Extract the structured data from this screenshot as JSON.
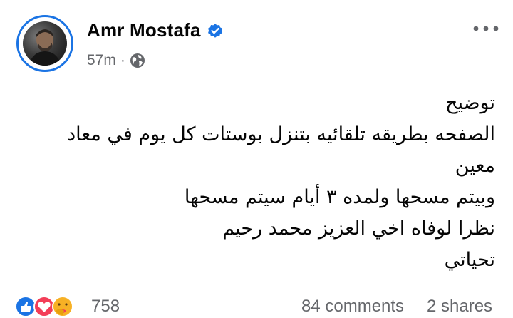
{
  "post": {
    "author": "Amr Mostafa",
    "time": "57m",
    "separator": "·",
    "audience_icon": "globe-icon",
    "verified_icon": "verified-badge-icon",
    "more_icon": "more-options-icon",
    "body_lines": [
      "توضيح",
      "الصفحه بطريقه تلقائيه بتنزل بوستات  كل يوم في معاد",
      "معين",
      "وبيتم مسحها ولمده ٣ أيام سيتم مسحها",
      "نظرا لوفاه اخي العزيز محمد رحيم",
      "تحياتي"
    ]
  },
  "footer": {
    "reaction_icons": [
      "like-icon",
      "love-icon",
      "care-icon"
    ],
    "reaction_count": "758",
    "comments": "84 comments",
    "shares": "2 shares"
  },
  "colors": {
    "accent": "#1b74e4",
    "secondary_text": "#65676b",
    "love": "#f33e58",
    "care": "#f7b125"
  }
}
